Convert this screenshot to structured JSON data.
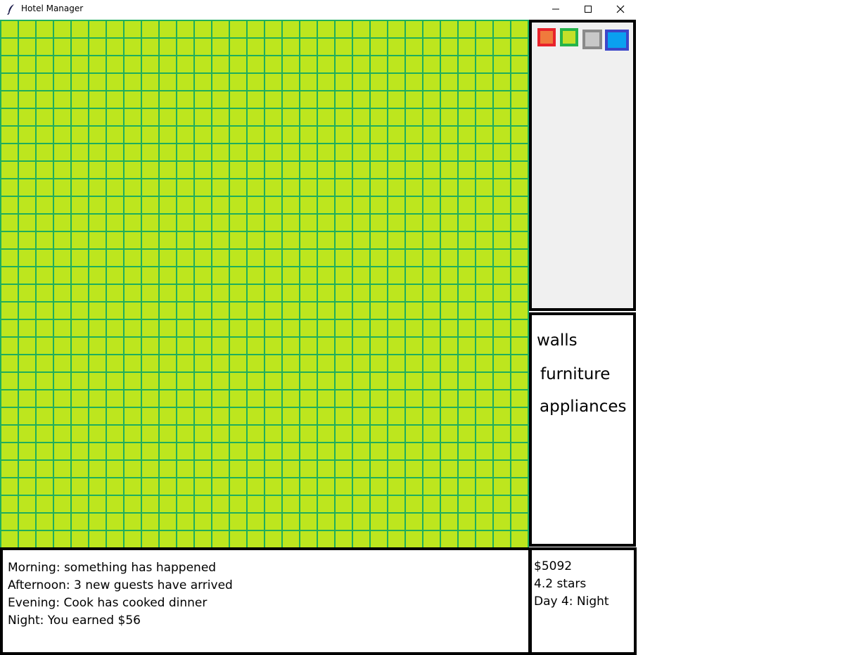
{
  "window": {
    "title": "Hotel Manager",
    "icons": {
      "app": "feather-icon",
      "minimize": "minimize-icon",
      "maximize": "maximize-icon",
      "close": "close-icon"
    }
  },
  "colors": {
    "grass_fill": "#bde61e",
    "grid_line": "#1fae5c",
    "palette_bg": "#f0f0f0",
    "panel_border": "#000000"
  },
  "palette": {
    "swatches": [
      {
        "id": "red",
        "border": "#e8232c",
        "fill": "#f07a3c"
      },
      {
        "id": "green",
        "border": "#25b44a",
        "fill": "#c3e02a"
      },
      {
        "id": "gray",
        "border": "#8a8a8a",
        "fill": "#c8c8c8"
      },
      {
        "id": "blue",
        "border": "#3c46c8",
        "fill": "#0aa0f0"
      }
    ]
  },
  "categories": {
    "walls": "walls",
    "furniture": "furniture",
    "appliances": "appliances"
  },
  "log": {
    "morning": "Morning: something has happened",
    "afternoon": "Afternoon: 3 new guests have arrived",
    "evening": "Evening: Cook has cooked dinner",
    "night": "Night: You earned $56"
  },
  "stats": {
    "money": "$5092",
    "rating": "4.2 stars",
    "day": "Day 4: Night"
  }
}
